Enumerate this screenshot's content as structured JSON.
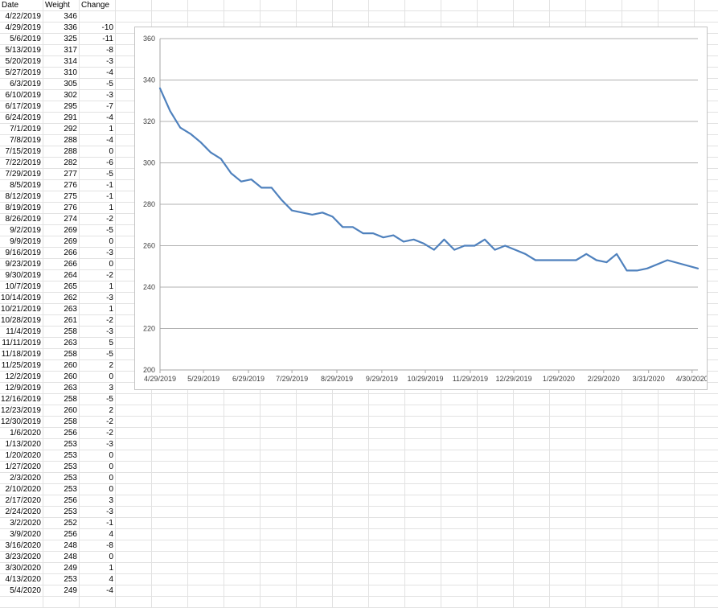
{
  "sheet": {
    "headers": [
      "Date",
      "Weight",
      "Change"
    ],
    "rows": [
      [
        "4/22/2019",
        "346",
        ""
      ],
      [
        "4/29/2019",
        "336",
        "-10"
      ],
      [
        "5/6/2019",
        "325",
        "-11"
      ],
      [
        "5/13/2019",
        "317",
        "-8"
      ],
      [
        "5/20/2019",
        "314",
        "-3"
      ],
      [
        "5/27/2019",
        "310",
        "-4"
      ],
      [
        "6/3/2019",
        "305",
        "-5"
      ],
      [
        "6/10/2019",
        "302",
        "-3"
      ],
      [
        "6/17/2019",
        "295",
        "-7"
      ],
      [
        "6/24/2019",
        "291",
        "-4"
      ],
      [
        "7/1/2019",
        "292",
        "1"
      ],
      [
        "7/8/2019",
        "288",
        "-4"
      ],
      [
        "7/15/2019",
        "288",
        "0"
      ],
      [
        "7/22/2019",
        "282",
        "-6"
      ],
      [
        "7/29/2019",
        "277",
        "-5"
      ],
      [
        "8/5/2019",
        "276",
        "-1"
      ],
      [
        "8/12/2019",
        "275",
        "-1"
      ],
      [
        "8/19/2019",
        "276",
        "1"
      ],
      [
        "8/26/2019",
        "274",
        "-2"
      ],
      [
        "9/2/2019",
        "269",
        "-5"
      ],
      [
        "9/9/2019",
        "269",
        "0"
      ],
      [
        "9/16/2019",
        "266",
        "-3"
      ],
      [
        "9/23/2019",
        "266",
        "0"
      ],
      [
        "9/30/2019",
        "264",
        "-2"
      ],
      [
        "10/7/2019",
        "265",
        "1"
      ],
      [
        "10/14/2019",
        "262",
        "-3"
      ],
      [
        "10/21/2019",
        "263",
        "1"
      ],
      [
        "10/28/2019",
        "261",
        "-2"
      ],
      [
        "11/4/2019",
        "258",
        "-3"
      ],
      [
        "11/11/2019",
        "263",
        "5"
      ],
      [
        "11/18/2019",
        "258",
        "-5"
      ],
      [
        "11/25/2019",
        "260",
        "2"
      ],
      [
        "12/2/2019",
        "260",
        "0"
      ],
      [
        "12/9/2019",
        "263",
        "3"
      ],
      [
        "12/16/2019",
        "258",
        "-5"
      ],
      [
        "12/23/2019",
        "260",
        "2"
      ],
      [
        "12/30/2019",
        "258",
        "-2"
      ],
      [
        "1/6/2020",
        "256",
        "-2"
      ],
      [
        "1/13/2020",
        "253",
        "-3"
      ],
      [
        "1/20/2020",
        "253",
        "0"
      ],
      [
        "1/27/2020",
        "253",
        "0"
      ],
      [
        "2/3/2020",
        "253",
        "0"
      ],
      [
        "2/10/2020",
        "253",
        "0"
      ],
      [
        "2/17/2020",
        "256",
        "3"
      ],
      [
        "2/24/2020",
        "253",
        "-3"
      ],
      [
        "3/2/2020",
        "252",
        "-1"
      ],
      [
        "3/9/2020",
        "256",
        "4"
      ],
      [
        "3/16/2020",
        "248",
        "-8"
      ],
      [
        "3/23/2020",
        "248",
        "0"
      ],
      [
        "3/30/2020",
        "249",
        "1"
      ],
      [
        "4/13/2020",
        "253",
        "4"
      ],
      [
        "5/4/2020",
        "249",
        "-4"
      ]
    ]
  },
  "chart_data": {
    "type": "line",
    "x": [
      "2019-04-29",
      "2019-05-06",
      "2019-05-13",
      "2019-05-20",
      "2019-05-27",
      "2019-06-03",
      "2019-06-10",
      "2019-06-17",
      "2019-06-24",
      "2019-07-01",
      "2019-07-08",
      "2019-07-15",
      "2019-07-22",
      "2019-07-29",
      "2019-08-05",
      "2019-08-12",
      "2019-08-19",
      "2019-08-26",
      "2019-09-02",
      "2019-09-09",
      "2019-09-16",
      "2019-09-23",
      "2019-09-30",
      "2019-10-07",
      "2019-10-14",
      "2019-10-21",
      "2019-10-28",
      "2019-11-04",
      "2019-11-11",
      "2019-11-18",
      "2019-11-25",
      "2019-12-02",
      "2019-12-09",
      "2019-12-16",
      "2019-12-23",
      "2019-12-30",
      "2020-01-06",
      "2020-01-13",
      "2020-01-20",
      "2020-01-27",
      "2020-02-03",
      "2020-02-10",
      "2020-02-17",
      "2020-02-24",
      "2020-03-02",
      "2020-03-09",
      "2020-03-16",
      "2020-03-23",
      "2020-03-30",
      "2020-04-13",
      "2020-05-04"
    ],
    "series": [
      {
        "values": [
          336,
          325,
          317,
          314,
          310,
          305,
          302,
          295,
          291,
          292,
          288,
          288,
          282,
          277,
          276,
          275,
          276,
          274,
          269,
          269,
          266,
          266,
          264,
          265,
          262,
          263,
          261,
          258,
          263,
          258,
          260,
          260,
          263,
          258,
          260,
          258,
          256,
          253,
          253,
          253,
          253,
          253,
          256,
          253,
          252,
          256,
          248,
          248,
          249,
          253,
          249
        ]
      }
    ],
    "xlim": [
      "2019-04-29",
      "2020-05-04"
    ],
    "ylim": [
      200,
      360
    ],
    "yticks": [
      200,
      220,
      240,
      260,
      280,
      300,
      320,
      340,
      360
    ],
    "xtick_dates": [
      "2019-04-29",
      "2019-05-29",
      "2019-06-29",
      "2019-07-29",
      "2019-08-29",
      "2019-09-29",
      "2019-10-29",
      "2019-11-29",
      "2019-12-29",
      "2020-01-29",
      "2020-02-29",
      "2020-03-31",
      "2020-04-30"
    ],
    "xtick_labels": [
      "4/29/2019",
      "5/29/2019",
      "6/29/2019",
      "7/29/2019",
      "8/29/2019",
      "9/29/2019",
      "10/29/2019",
      "11/29/2019",
      "12/29/2019",
      "1/29/2020",
      "2/29/2020",
      "3/31/2020",
      "4/30/2020"
    ],
    "line_color": "#4f81bd",
    "grid": true,
    "legend": "none"
  }
}
